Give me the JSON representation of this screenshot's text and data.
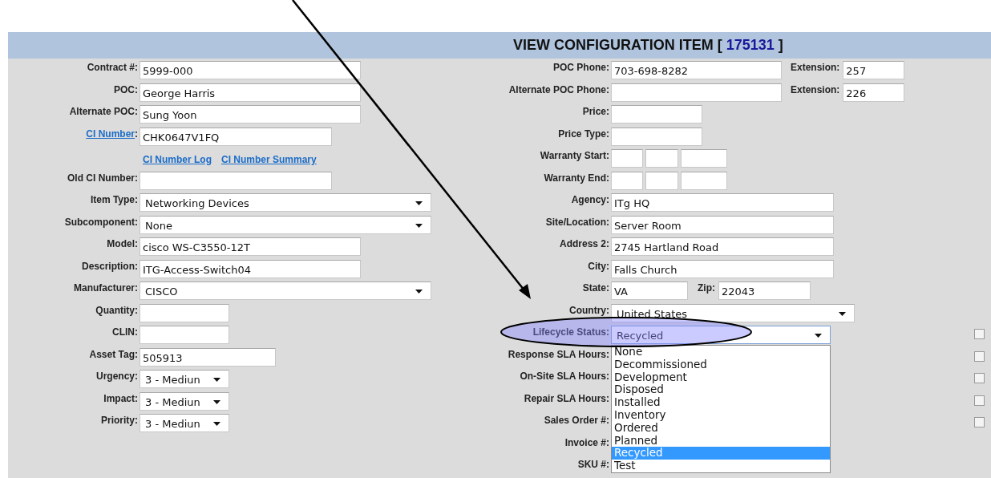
{
  "header": {
    "title": "VIEW CONFIGURATION ITEM [",
    "item_id": "175131",
    "closing": "]"
  },
  "left_fields": [
    {
      "label": "Contract #:",
      "kind": "text",
      "value": "5999-000"
    },
    {
      "label": "POC:",
      "kind": "text",
      "value": "George Harris"
    },
    {
      "label": "Alternate POC:",
      "kind": "text",
      "value": "Sung Yoon"
    },
    {
      "label": "CI Number",
      "suffix": ":",
      "kind": "link-text",
      "value": "CHK0647V1FQ"
    },
    {
      "kind": "links",
      "links": [
        "CI Number Log",
        "CI Number Summary"
      ]
    },
    {
      "label": "Old CI Number:",
      "kind": "text"
    },
    {
      "label": "Item Type:",
      "kind": "select",
      "value": "Networking Devices"
    },
    {
      "label": "Subcomponent:",
      "kind": "select",
      "value": "None"
    },
    {
      "label": "Model:",
      "kind": "text",
      "value": "cisco WS-C3550-12T"
    },
    {
      "label": "Description:",
      "kind": "text",
      "value": "ITG-Access-Switch04"
    },
    {
      "label": "Manufacturer:",
      "kind": "select",
      "value": "CISCO"
    },
    {
      "label": "Quantity:",
      "kind": "text"
    },
    {
      "label": "CLIN:",
      "kind": "text"
    },
    {
      "label": "Asset Tag:",
      "kind": "text",
      "value": "505913"
    },
    {
      "label": "Urgency:",
      "kind": "select",
      "value": "3 - Mediun"
    },
    {
      "label": "Impact:",
      "kind": "select",
      "value": "3 - Mediun"
    },
    {
      "label": "Priority:",
      "kind": "select",
      "value": "3 - Mediun"
    }
  ],
  "right_fields": [
    {
      "label": "POC Phone:",
      "kind": "pair",
      "value": "703-698-8282",
      "extra_label": "Extension:",
      "extra_value": "257"
    },
    {
      "label": "Alternate POC Phone:",
      "kind": "pair",
      "extra_label": "Extension:",
      "extra_value": "226"
    },
    {
      "label": "Price:",
      "kind": "text"
    },
    {
      "label": "Price Type:",
      "kind": "text"
    },
    {
      "label": "Warranty Start:",
      "kind": "date"
    },
    {
      "label": "Warranty End:",
      "kind": "date"
    },
    {
      "label": "Agency:",
      "kind": "text",
      "value": "ITg HQ"
    },
    {
      "label": "Site/Location:",
      "kind": "text",
      "value": "Server Room"
    },
    {
      "label": "Address 2:",
      "kind": "text",
      "value": "2745 Hartland Road"
    },
    {
      "label": "City:",
      "kind": "text",
      "value": "Falls Church"
    },
    {
      "label": "State:",
      "kind": "state",
      "value": "VA",
      "extra_label": "Zip:",
      "extra_value": "22043"
    },
    {
      "label": "Country:",
      "kind": "select",
      "value": "United States"
    },
    {
      "label": "Lifecycle Status:",
      "kind": "select",
      "value": "Recycled",
      "checked": false,
      "open": true
    },
    {
      "label": "Response SLA Hours:",
      "kind": "label",
      "checked": false
    },
    {
      "label": "On-Site SLA Hours:",
      "kind": "label",
      "checked": false
    },
    {
      "label": "Repair SLA Hours:",
      "kind": "label",
      "checked": false
    },
    {
      "label": "Sales Order #:",
      "kind": "label",
      "checked": false
    },
    {
      "label": "Invoice #:",
      "kind": "label"
    },
    {
      "label": "SKU #:",
      "kind": "label"
    }
  ],
  "dropdown_options": [
    {
      "label": "None",
      "selected": false
    },
    {
      "label": "Decommissioned",
      "selected": false
    },
    {
      "label": "Development",
      "selected": false
    },
    {
      "label": "Disposed",
      "selected": false
    },
    {
      "label": "Installed",
      "selected": false
    },
    {
      "label": "Inventory",
      "selected": false
    },
    {
      "label": "Ordered",
      "selected": false
    },
    {
      "label": "Planned",
      "selected": false
    },
    {
      "label": "Recycled",
      "selected": true
    },
    {
      "label": "Test",
      "selected": false
    }
  ]
}
